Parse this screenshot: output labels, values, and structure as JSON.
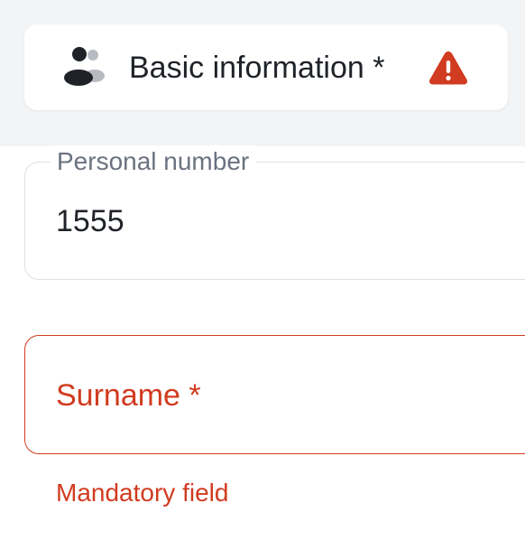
{
  "tab": {
    "label": "Basic information *",
    "icon": "person-group-icon",
    "status_icon": "warning-icon",
    "status_color": "#d13b1f"
  },
  "form": {
    "personal_number": {
      "label": "Personal number",
      "value": "1555"
    },
    "surname": {
      "label": "Surname *",
      "value": "",
      "error": "Mandatory field"
    }
  },
  "colors": {
    "error": "#d13b1f",
    "label": "#6b7280",
    "text": "#1f2328",
    "background_band": "#f3f4f6"
  }
}
